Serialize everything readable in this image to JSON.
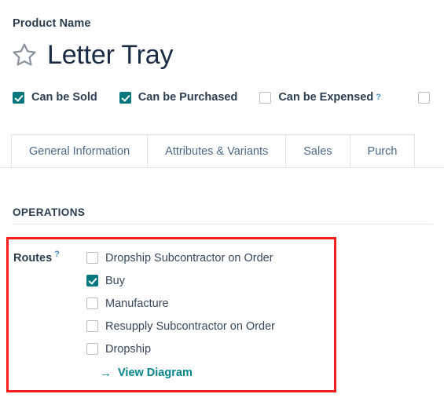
{
  "form": {
    "product_name_label": "Product Name",
    "product_title": "Letter Tray",
    "favorite_icon": "star-outline-icon"
  },
  "flags": [
    {
      "label": "Can be Sold",
      "checked": true,
      "help": null
    },
    {
      "label": "Can be Purchased",
      "checked": true,
      "help": null
    },
    {
      "label": "Can be Expensed",
      "checked": false,
      "help": "?"
    },
    {
      "label": "",
      "checked": false,
      "help": null
    }
  ],
  "tabs": [
    {
      "label": "General Information",
      "active": true
    },
    {
      "label": "Attributes & Variants",
      "active": false
    },
    {
      "label": "Sales",
      "active": false
    },
    {
      "label": "Purch",
      "active": false
    }
  ],
  "operations": {
    "heading": "OPERATIONS",
    "routes_label": "Routes",
    "routes_help": "?",
    "routes": [
      {
        "label": "Dropship Subcontractor on Order",
        "checked": false
      },
      {
        "label": "Buy",
        "checked": true
      },
      {
        "label": "Manufacture",
        "checked": false
      },
      {
        "label": "Resupply Subcontractor on Order",
        "checked": false
      },
      {
        "label": "Dropship",
        "checked": false
      }
    ],
    "view_diagram_label": "View Diagram",
    "view_diagram_arrow": "→"
  },
  "colors": {
    "accent_teal": "#00787d",
    "link_teal": "#00868c",
    "help_blue": "#4a8fd4",
    "highlight_red": "#f91c1c",
    "text_dark": "#2b3d4f"
  }
}
